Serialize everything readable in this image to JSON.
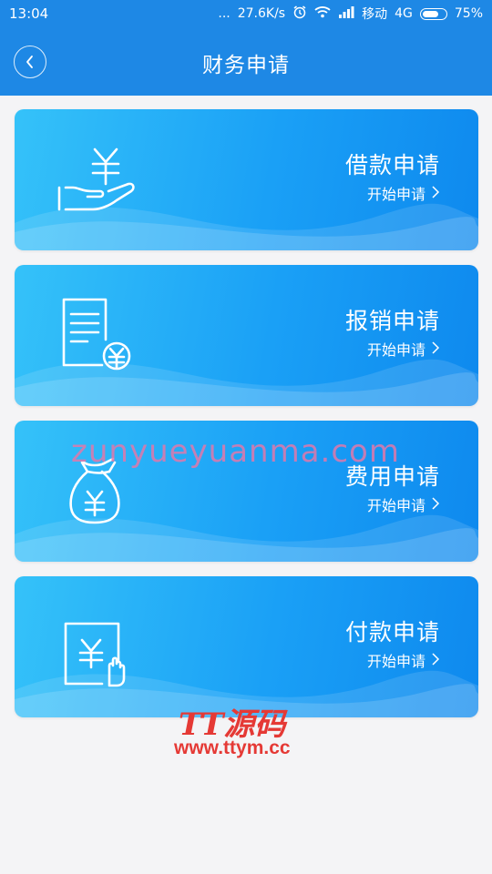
{
  "status_bar": {
    "time": "13:04",
    "dots": "...",
    "speed": "27.6K/s",
    "carrier": "移动",
    "network": "4G",
    "battery": "75%",
    "battery_level": 0.75
  },
  "header": {
    "title": "财务申请"
  },
  "cards": [
    {
      "title": "借款申请",
      "action": "开始申请",
      "icon": "hand-yuan-icon"
    },
    {
      "title": "报销申请",
      "action": "开始申请",
      "icon": "document-yuan-icon"
    },
    {
      "title": "费用申请",
      "action": "开始申请",
      "icon": "money-bag-icon"
    },
    {
      "title": "付款申请",
      "action": "开始申请",
      "icon": "payment-hand-icon"
    }
  ],
  "watermarks": {
    "domain": "zunyueyuanma.com",
    "brand": "TT源码",
    "url": "www.ttym.cc"
  },
  "colors": {
    "primary": "#1e88e5",
    "card_start": "#35c2f9",
    "card_end": "#0e89ee",
    "background": "#f4f4f6"
  }
}
